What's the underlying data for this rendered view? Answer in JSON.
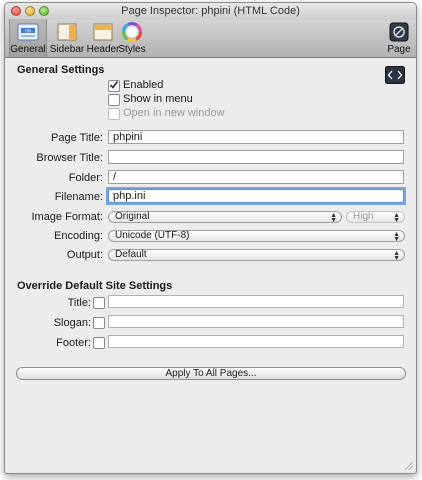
{
  "window": {
    "title": "Page Inspector: phpini (HTML Code)"
  },
  "toolbar": {
    "general": "General",
    "sidebar": "Sidebar",
    "header": "Header",
    "styles": "Styles",
    "page": "Page"
  },
  "general_settings": {
    "heading": "General Settings",
    "enabled": {
      "label": "Enabled",
      "checked": true
    },
    "show_in_menu": {
      "label": "Show in menu",
      "checked": false
    },
    "open_new_window": {
      "label": "Open in new window",
      "checked": false,
      "disabled": true
    }
  },
  "fields": {
    "page_title": {
      "label": "Page Title:",
      "value": "phpini"
    },
    "browser_title": {
      "label": "Browser Title:",
      "value": ""
    },
    "folder": {
      "label": "Folder:",
      "value": "/"
    },
    "filename": {
      "label": "Filename:",
      "value": "php.ini"
    }
  },
  "image_format": {
    "label": "Image Format:",
    "value": "Original",
    "quality": "High"
  },
  "encoding": {
    "label": "Encoding:",
    "value": "Unicode (UTF-8)"
  },
  "output": {
    "label": "Output:",
    "value": "Default"
  },
  "override": {
    "heading": "Override Default Site Settings",
    "title_label": "Title:",
    "slogan_label": "Slogan:",
    "footer_label": "Footer:"
  },
  "apply_button": "Apply To All Pages...",
  "colors": {
    "focus_ring": "#7aa7e0",
    "window_bg": "#ececec"
  }
}
